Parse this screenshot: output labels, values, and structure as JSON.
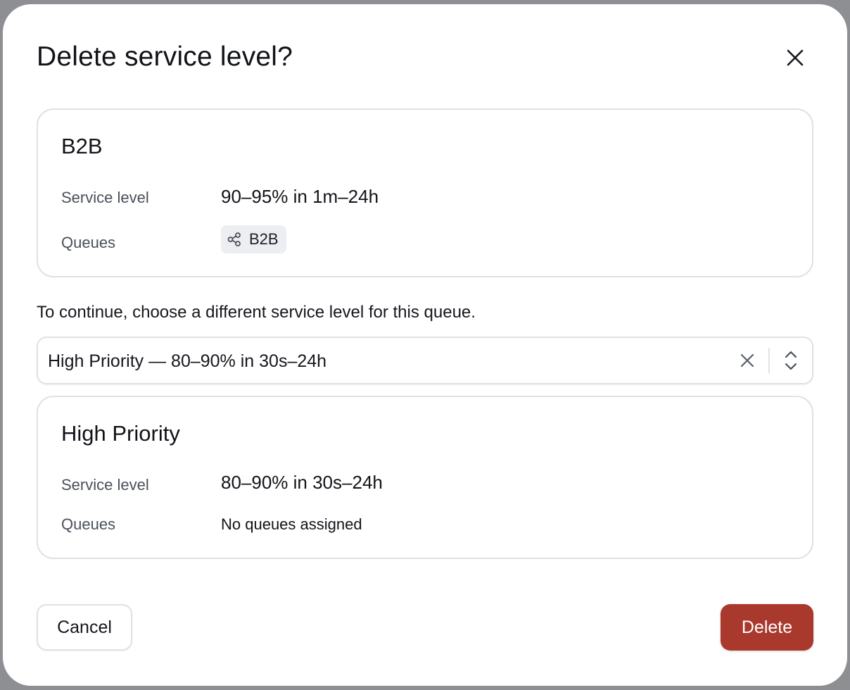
{
  "dialog": {
    "title": "Delete service level?",
    "close_icon": "close-icon"
  },
  "current_level": {
    "name": "B2B",
    "service_level_label": "Service level",
    "service_level_value": "90–95% in 1m–24h",
    "queues_label": "Queues",
    "queue_chip": {
      "icon": "share-icon",
      "label": "B2B"
    }
  },
  "instruction": "To continue, choose a different service level for this queue.",
  "replacement_select": {
    "selected_value": "High Priority — 80–90% in 30s–24h",
    "clear_icon": "close-icon",
    "toggle_icon": "chevron-up-down-icon"
  },
  "replacement_level": {
    "name": "High Priority",
    "service_level_label": "Service level",
    "service_level_value": "80–90% in 30s–24h",
    "queues_label": "Queues",
    "queues_value": "No queues assigned"
  },
  "footer": {
    "cancel_label": "Cancel",
    "delete_label": "Delete"
  },
  "colors": {
    "overlay": "#8e8f93",
    "danger": "#a9382d",
    "border": "#dfe1e6",
    "chip_bg": "#eceef2"
  }
}
